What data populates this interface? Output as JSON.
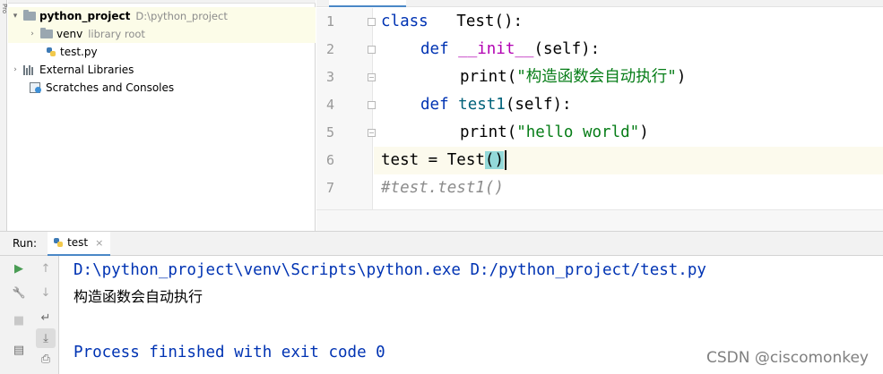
{
  "project_tree": {
    "root_name": "python_project",
    "root_path": "D:\\python_project",
    "venv_name": "venv",
    "venv_note": "library root",
    "file_name": "test.py",
    "external_libraries": "External Libraries",
    "scratches": "Scratches and Consoles"
  },
  "editor": {
    "line_numbers": [
      "1",
      "2",
      "3",
      "4",
      "5",
      "6",
      "7"
    ],
    "lines": {
      "l1_kw": "class",
      "l1_name": "Test():",
      "l2_kw": "def",
      "l2_fn": "__init__",
      "l2_param": "(self):",
      "l3_fn": "print",
      "l3_open": "(",
      "l3_str": "\"构造函数会自动执行\"",
      "l3_close": ")",
      "l4_kw": "def",
      "l4_fn": "test1",
      "l4_param": "(self):",
      "l5_fn": "print",
      "l5_open": "(",
      "l5_str": "\"hello world\"",
      "l5_close": ")",
      "l6_code": "test = Test",
      "l6_paren": "()",
      "l7_comment": "#test.test1()"
    }
  },
  "run_panel": {
    "label": "Run:",
    "tab_name": "test",
    "close_glyph": "×",
    "output": [
      "D:\\python_project\\venv\\Scripts\\python.exe D:/python_project/test.py",
      "构造函数会自动执行",
      "",
      "Process finished with exit code 0"
    ]
  },
  "watermark": "CSDN @ciscomonkey",
  "icons": {
    "tree_arrow_expanded": "▾",
    "tree_arrow_collapsed": "›",
    "run": "▶",
    "up": "↑",
    "wrench": "🔧",
    "stop": "■",
    "wrap": "↵",
    "scroll_end": "⤓",
    "layout": "▤",
    "print": "⎙"
  }
}
